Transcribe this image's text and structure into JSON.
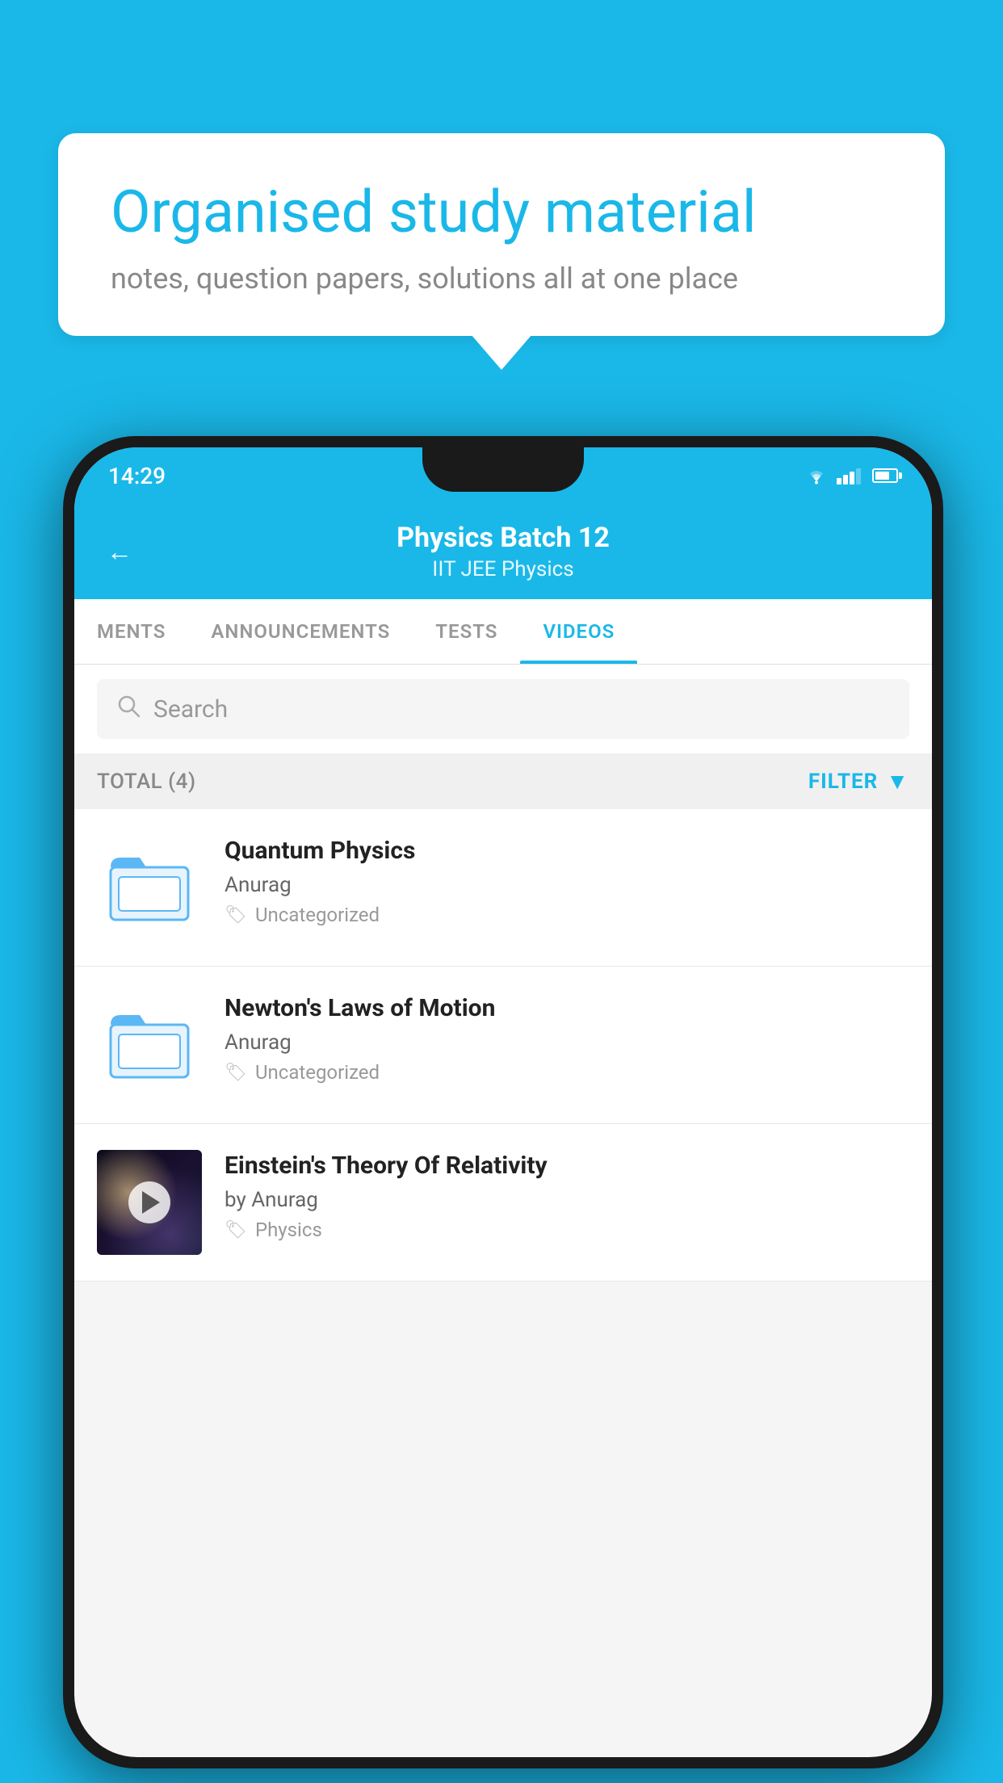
{
  "background_color": "#1ab8e8",
  "speech_bubble": {
    "title": "Organised study material",
    "subtitle": "notes, question papers, solutions all at one place"
  },
  "status_bar": {
    "time": "14:29"
  },
  "app_header": {
    "title": "Physics Batch 12",
    "subtitle_parts": [
      "IIT JEE",
      "Physics"
    ],
    "subtitle": "IIT JEE   Physics",
    "back_label": "←"
  },
  "tabs": [
    {
      "label": "MENTS",
      "active": false
    },
    {
      "label": "ANNOUNCEMENTS",
      "active": false
    },
    {
      "label": "TESTS",
      "active": false
    },
    {
      "label": "VIDEOS",
      "active": true
    }
  ],
  "search": {
    "placeholder": "Search"
  },
  "filter_bar": {
    "total_label": "TOTAL (4)",
    "filter_label": "FILTER"
  },
  "videos": [
    {
      "id": 1,
      "title": "Quantum Physics",
      "author": "Anurag",
      "tag": "Uncategorized",
      "type": "folder",
      "has_thumbnail": false
    },
    {
      "id": 2,
      "title": "Newton's Laws of Motion",
      "author": "Anurag",
      "tag": "Uncategorized",
      "type": "folder",
      "has_thumbnail": false
    },
    {
      "id": 3,
      "title": "Einstein's Theory Of Relativity",
      "author": "by Anurag",
      "tag": "Physics",
      "type": "video",
      "has_thumbnail": true
    }
  ]
}
